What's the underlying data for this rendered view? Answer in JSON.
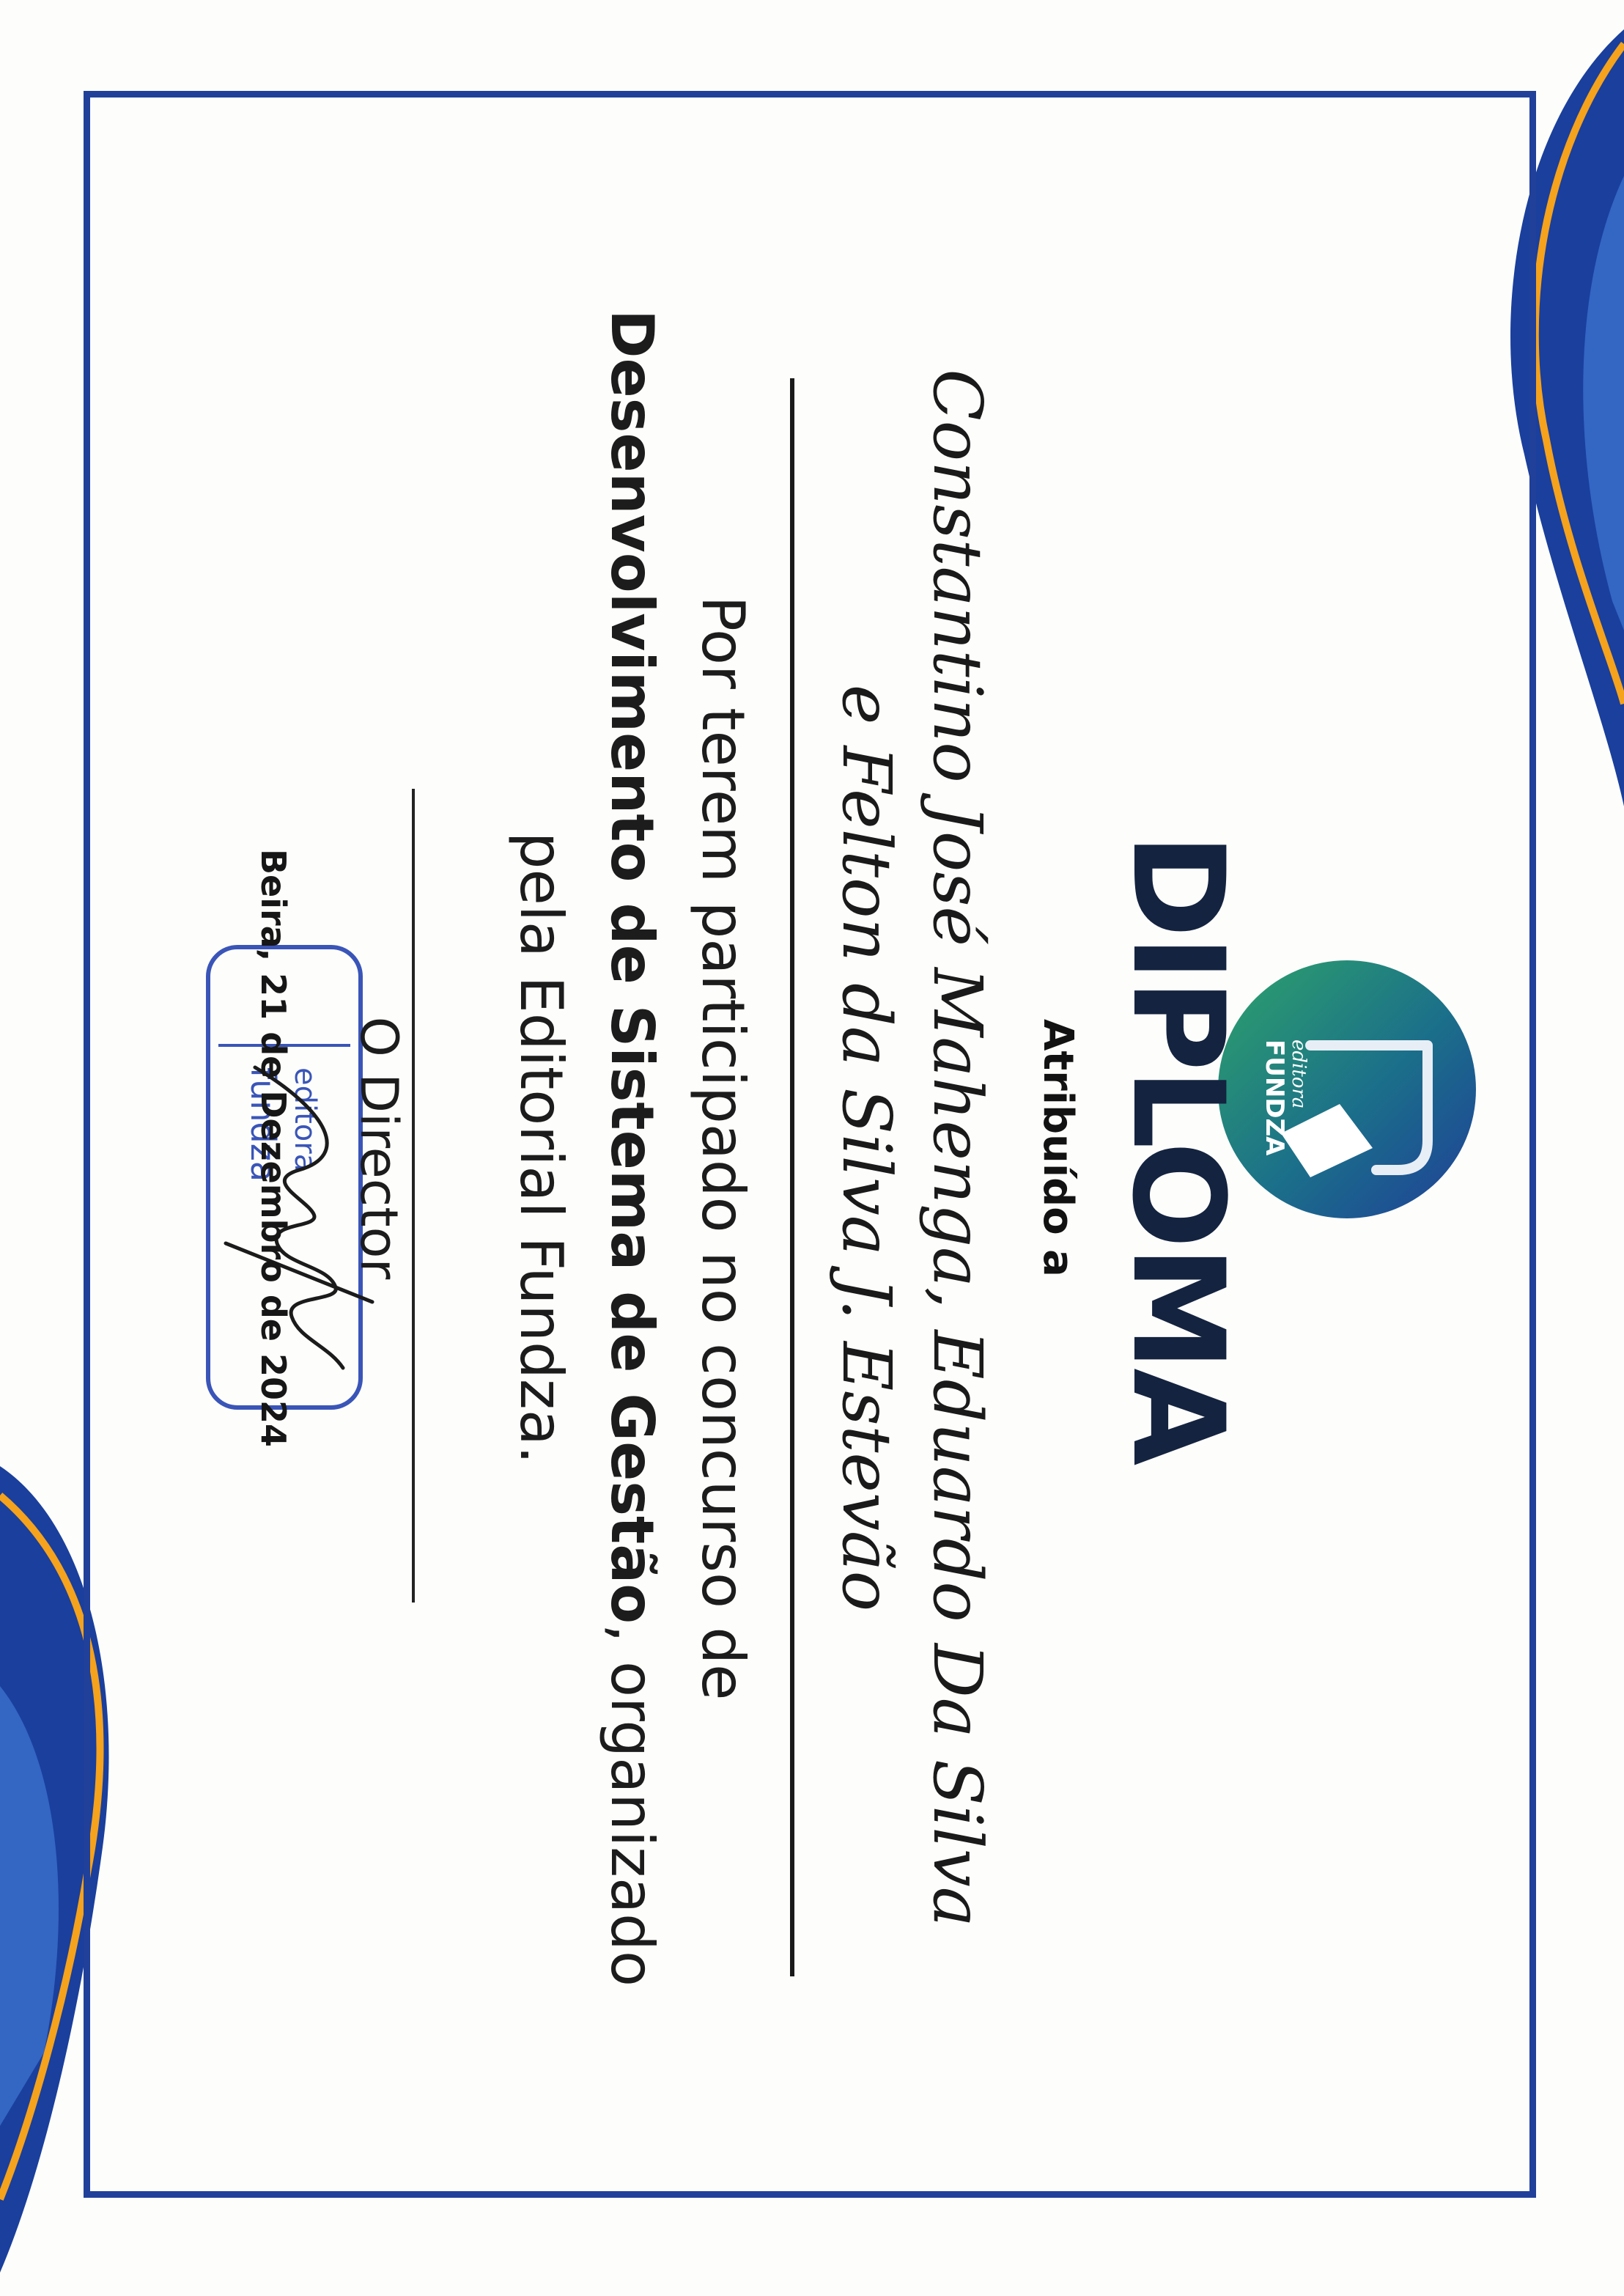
{
  "colors": {
    "frame": "#20409a",
    "swoosh_blue": "#1a3f9c",
    "swoosh_orange": "#f5a21d",
    "logo_green": "#2ea36a",
    "logo_blue": "#1f3f98",
    "title": "#14233f",
    "stamp": "#3a55b8"
  },
  "logo": {
    "brand_small": "editora",
    "brand_name": "FUNDZA",
    "icon": "pen-and-paper-icon"
  },
  "header": {
    "title": "DIPLOMA",
    "subtitle": "Atribuído a"
  },
  "recipients": {
    "line1": "Constantino José Mahenga, Eduardo Da Silva",
    "line2": "e Felton da Silva J. Estevão"
  },
  "statement": {
    "part1": "Por terem participado no concurso de ",
    "bold": "Desenvolvimento de Sistema de Gestão",
    "part2": ", organizado pela Editorial Fundza."
  },
  "signature_block": {
    "role": "O Director",
    "date": "Beira, 21 de Dezembro de 2024"
  },
  "stamp": {
    "line1": "editora",
    "line2": "fundza"
  }
}
